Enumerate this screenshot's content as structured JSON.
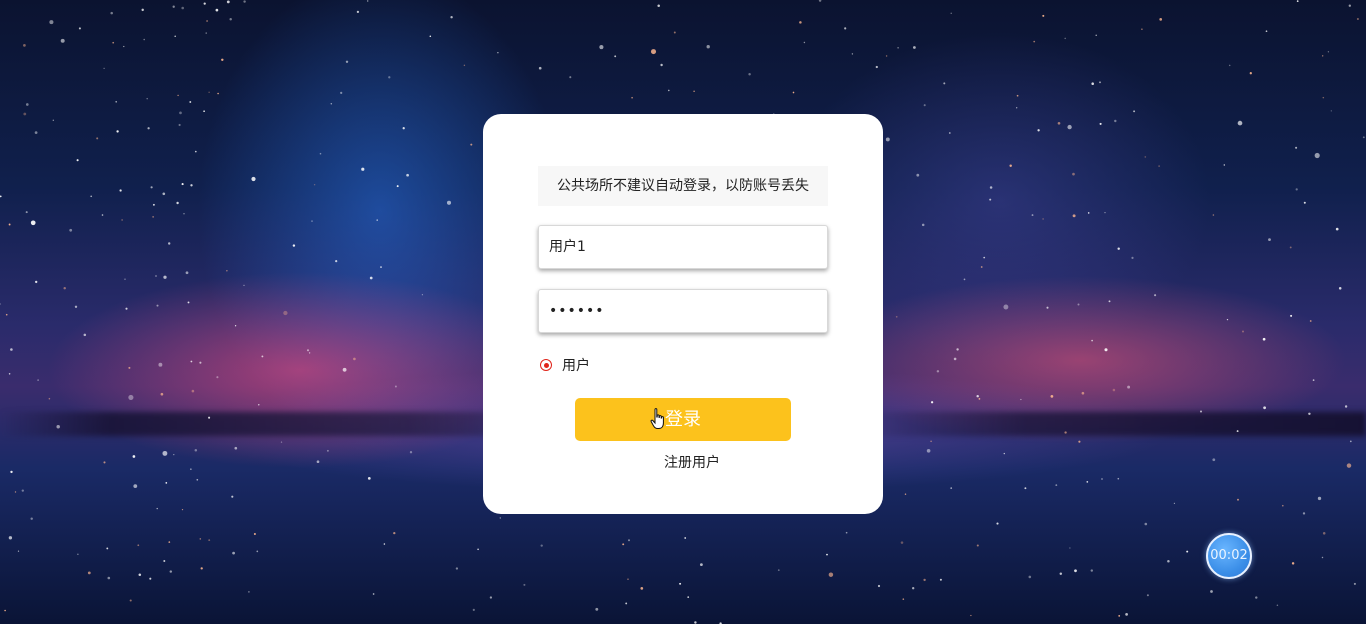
{
  "login": {
    "notice": "公共场所不建议自动登录，以防账号丢失",
    "username_value": "用户1",
    "password_value": "••••••",
    "role_option": "用户",
    "login_button": "登录",
    "register_link": "注册用户"
  },
  "timer": {
    "value": "00:02"
  },
  "colors": {
    "accent": "#fcc21c",
    "radio": "#e0251b",
    "timer": "#3c8fe8"
  },
  "icons": {
    "cursor": "hand-pointer-icon",
    "radio": "radio-selected-icon"
  }
}
